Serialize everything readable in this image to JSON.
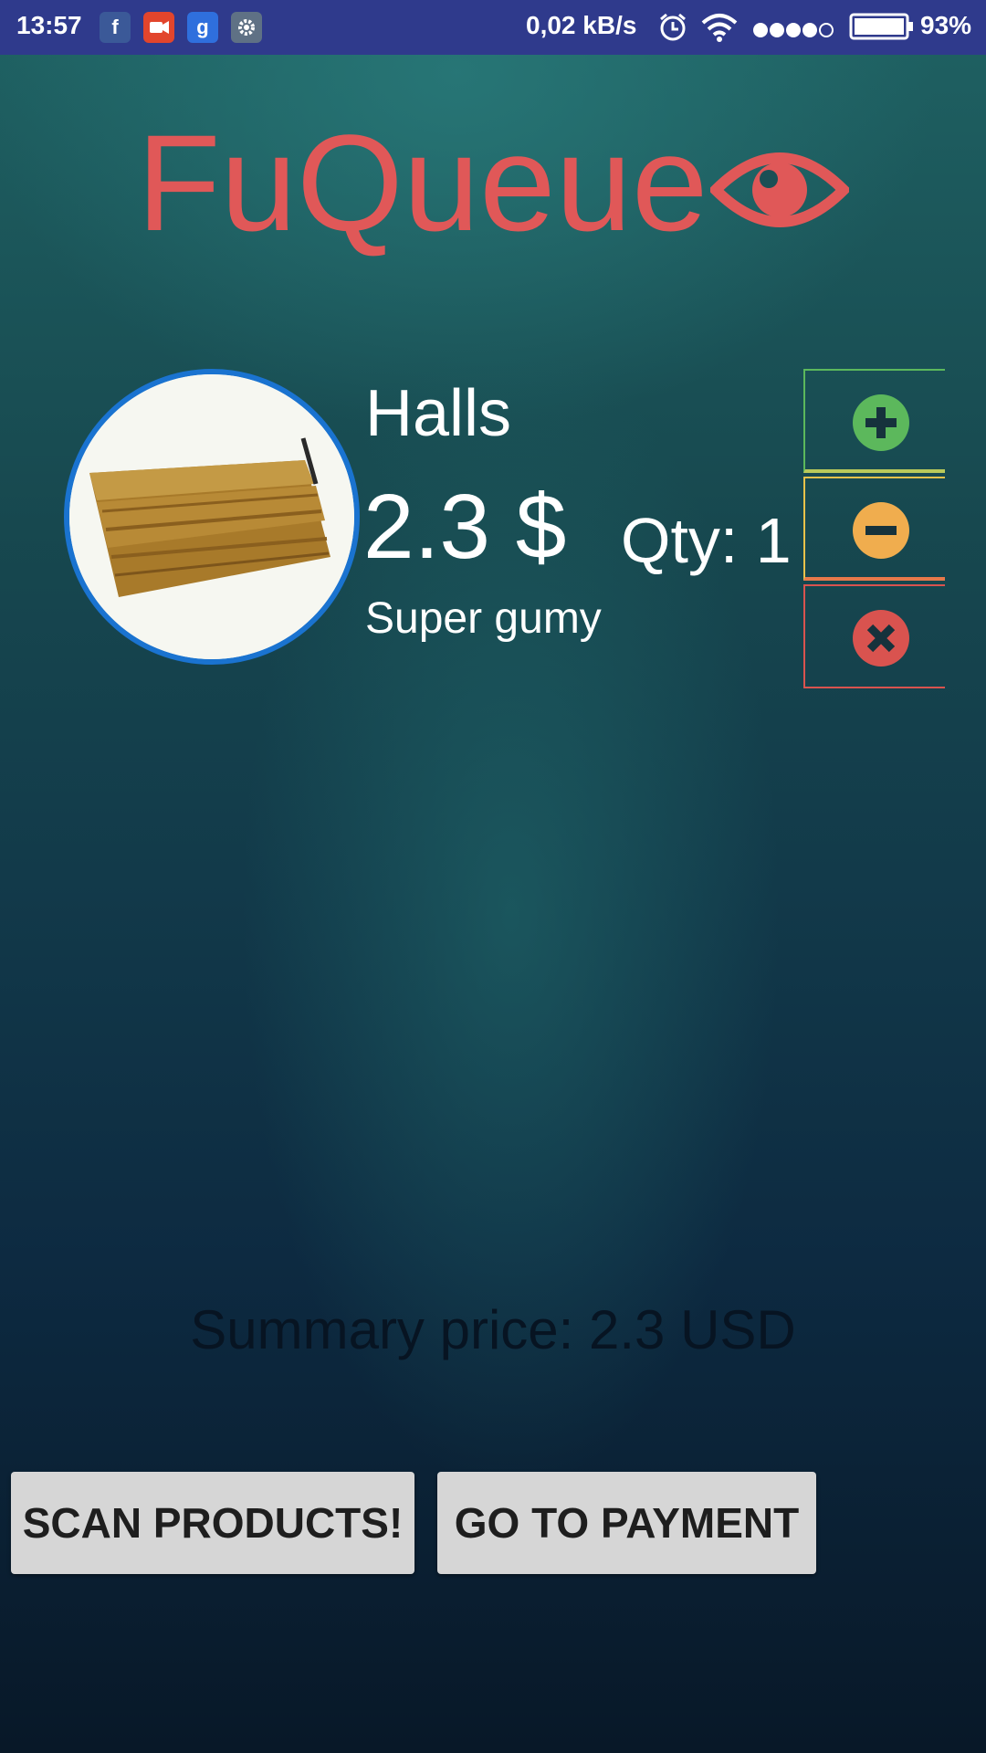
{
  "status_bar": {
    "time": "13:57",
    "network_speed": "0,02 kB/s",
    "battery": "93%",
    "app_icons": [
      "facebook-icon",
      "video-app-icon",
      "g-app-icon",
      "settings-app-icon"
    ],
    "app_icon_letters": {
      "facebook": "f",
      "g": "g"
    }
  },
  "header": {
    "title": "FuQueue",
    "title_color": "#e05858"
  },
  "cart": {
    "items": [
      {
        "name": "Halls",
        "price": "2.3 $",
        "qty": "Qty: 1",
        "description": "Super gumy"
      }
    ]
  },
  "summary": {
    "text": "Summary price: 2.3 USD"
  },
  "buttons": {
    "scan": "SCAN PRODUCTS!",
    "payment": "GO TO PAYMENT"
  },
  "colors": {
    "add": "#5cb85c",
    "remove": "#f0ad4e",
    "delete": "#d9534f",
    "status_bar": "#2f3a8c",
    "avatar_border": "#1a73d0"
  }
}
